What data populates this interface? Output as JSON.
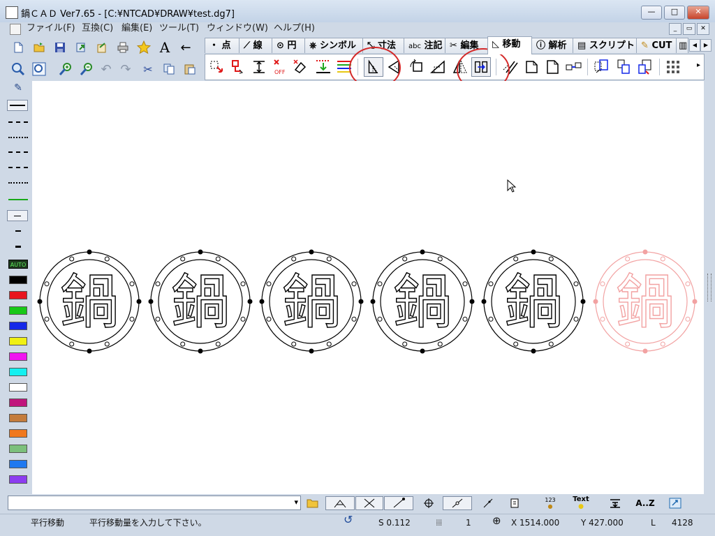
{
  "window": {
    "title": "鍋ＣＡＤ Ver7.65 - [C:¥NTCAD¥DRAW¥test.dg7]",
    "minimize_glyph": "—",
    "maximize_glyph": "□",
    "close_glyph": "✕"
  },
  "menu": {
    "items": [
      "ファイル(F)",
      "互換(C)",
      "編集(E)",
      "ツール(T)",
      "ウィンドウ(W)",
      "ヘルプ(H)"
    ],
    "mdi_buttons": [
      "_",
      "▭",
      "✕"
    ]
  },
  "toolbar": {
    "text_tool": "A",
    "back_arrow": "←"
  },
  "tabs": [
    {
      "icon": "・",
      "label": "点"
    },
    {
      "icon": "⟋",
      "label": "線"
    },
    {
      "icon": "⊙",
      "label": "円"
    },
    {
      "icon": "⎈",
      "label": "シンボル"
    },
    {
      "icon": "⤡",
      "label": "寸法"
    },
    {
      "icon": "abc",
      "label": "注記"
    },
    {
      "icon": "✂",
      "label": "編集"
    },
    {
      "icon": "◺",
      "label": "移動"
    },
    {
      "icon": "ⓘ",
      "label": "解析"
    },
    {
      "icon": "▤",
      "label": "スクリプト"
    },
    {
      "icon": "✎",
      "label": "CUT"
    },
    {
      "icon": "▥",
      "label": ""
    }
  ],
  "active_tab": "移動",
  "tab_scroll": [
    "◀",
    "▶"
  ],
  "palette": {
    "auto_label": "AUTO",
    "colors": [
      "#000000",
      "#e8141e",
      "#18c818",
      "#1428e8",
      "#f0f014",
      "#f014f0",
      "#14f0f0",
      "#ffffff",
      "#c0147c",
      "#c47c3c",
      "#f0781e",
      "#7cc07c",
      "#1e78f0",
      "#8c3cf0"
    ]
  },
  "drawing": {
    "kanji": "鍋",
    "stroke": "#000000",
    "ghost_stroke": "#f2a2a2"
  },
  "input": {
    "value": "",
    "dropdown_glyph": "▾"
  },
  "bottom_toolbar": {
    "text_button": "Text",
    "numbering_button": "123",
    "sort_button": "A..Z"
  },
  "status": {
    "mode": "平行移動",
    "prompt": "平行移動量を入力して下さい。",
    "scale": "S 0.112",
    "layer": "1",
    "x": "X 1514.000",
    "y": "Y 427.000",
    "l_label": "L",
    "l_value": "4128"
  }
}
